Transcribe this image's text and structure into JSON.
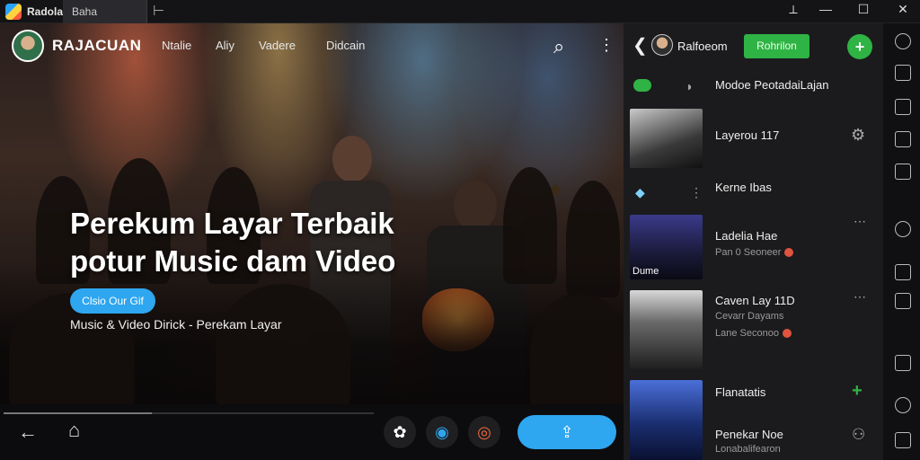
{
  "window": {
    "app_name": "Radolai",
    "tab_label": "Baha",
    "new_tab_glyph": "⊢",
    "controls": [
      "⟂",
      "—",
      "☐",
      "✕"
    ]
  },
  "header": {
    "brand": "RAJACUAN",
    "nav": [
      "Ntalie",
      "Aliy",
      "Vadere",
      "Didcain"
    ],
    "search_icon": "⌕",
    "more_icon": "⋮"
  },
  "hero": {
    "title_line1": "Perekum Layar Terbaik",
    "title_line2": "potur Music dam Video",
    "button_label": "Clsio Our Gif",
    "meta": "Music & Video   Dirick    - Perekam Layar"
  },
  "bottom_bar": {
    "back_icon": "←",
    "home_icon": "⌂",
    "tool_icons": [
      "✿",
      "◉",
      "◎"
    ],
    "share_icon": "⇪",
    "progress": 0.4
  },
  "panel": {
    "back_icon": "❮",
    "channel_name": "Ralfoeom",
    "follow_label": "Rohrilon",
    "add_icon": "+",
    "header_row": "Modoe PeotadaiLajan",
    "items": [
      {
        "title": "Layerou 117",
        "subtitle": "",
        "action_icon": "⚙"
      },
      {
        "title": "Kerne Ibas",
        "subtitle": "",
        "action_icon": "⋮"
      },
      {
        "title": "Ladelia Hae",
        "subtitle": "Pan 0 Seoneer",
        "action_icon": "⋯",
        "thumb_label": "Dume"
      },
      {
        "title": "Caven Lay 11D",
        "subtitle": "Cevarr Dayams",
        "subtitle2": "Lane Seconoo",
        "action_icon": "⋯"
      },
      {
        "title": "Flanatatis",
        "subtitle": "",
        "action_icon": "+"
      },
      {
        "title": "Penekar Noe",
        "subtitle": "Lonabalifearon",
        "action_icon": "⚇"
      }
    ]
  },
  "colors": {
    "accent": "#2ea6f0",
    "green": "#2fb344",
    "panel_bg": "#1b1b1d"
  }
}
